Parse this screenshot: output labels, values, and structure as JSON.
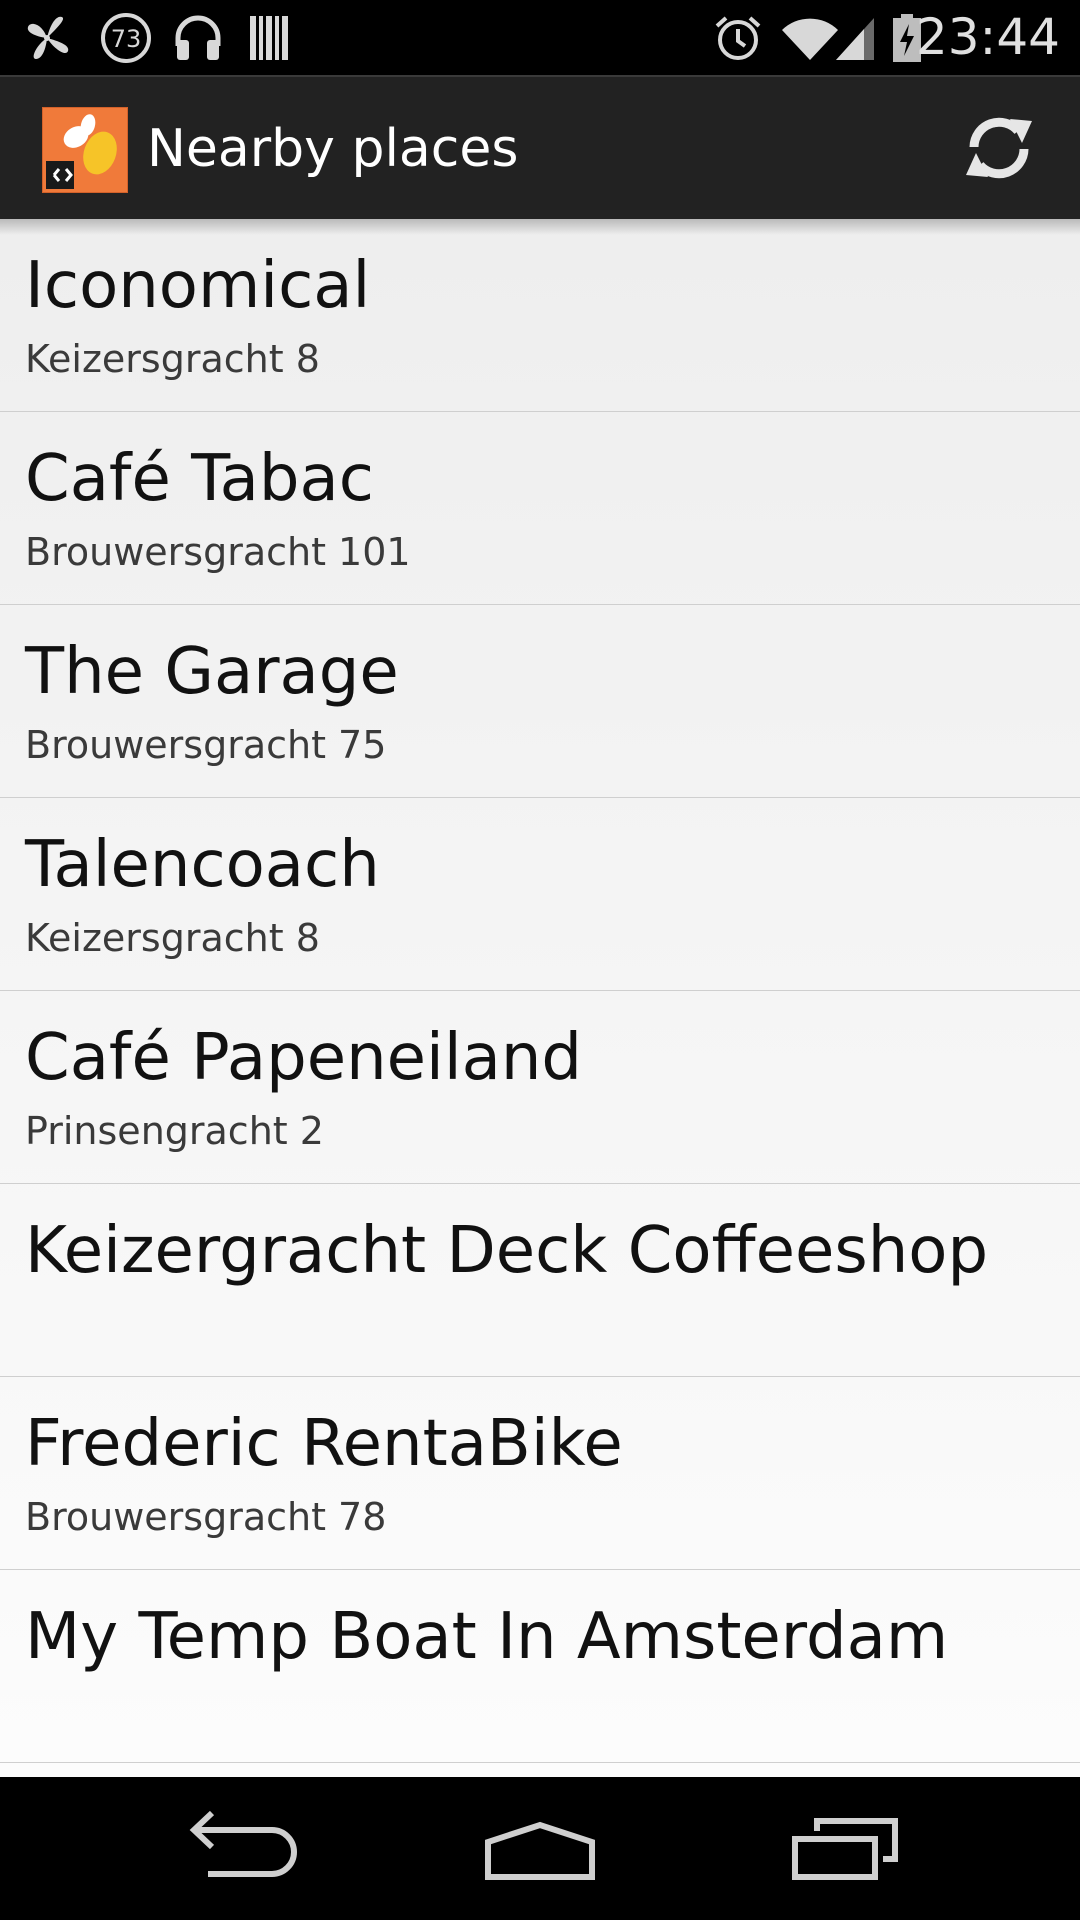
{
  "status_bar": {
    "time": "23:44",
    "notification_badge": "73",
    "icons": [
      "pinwheel-icon",
      "notification-count-icon",
      "headphones-icon",
      "barcode-icon",
      "alarm-icon",
      "wifi-icon",
      "signal-icon",
      "battery-charging-icon"
    ]
  },
  "action_bar": {
    "title": "Nearby places",
    "logo_icon": "app-logo-icon",
    "refresh_icon": "refresh-icon"
  },
  "places": [
    {
      "name": "Iconomical",
      "address": "Keizersgracht 8"
    },
    {
      "name": "Café Tabac",
      "address": "Brouwersgracht 101"
    },
    {
      "name": "The Garage",
      "address": "Brouwersgracht 75"
    },
    {
      "name": "Talencoach",
      "address": "Keizersgracht 8"
    },
    {
      "name": "Café Papeneiland",
      "address": "Prinsengracht 2"
    },
    {
      "name": "Keizergracht Deck Coffeeshop",
      "address": ""
    },
    {
      "name": "Frederic RentaBike",
      "address": "Brouwersgracht 78"
    },
    {
      "name": "My Temp Boat In Amsterdam",
      "address": ""
    }
  ],
  "nav_bar": {
    "icons": [
      "back-icon",
      "home-icon",
      "recent-apps-icon"
    ]
  },
  "colors": {
    "action_bar": "#222222",
    "logo_orange": "#f07a3a",
    "logo_yellow": "#f6c428",
    "list_background": "#f2f2f2",
    "divider": "#cfcfcf"
  }
}
